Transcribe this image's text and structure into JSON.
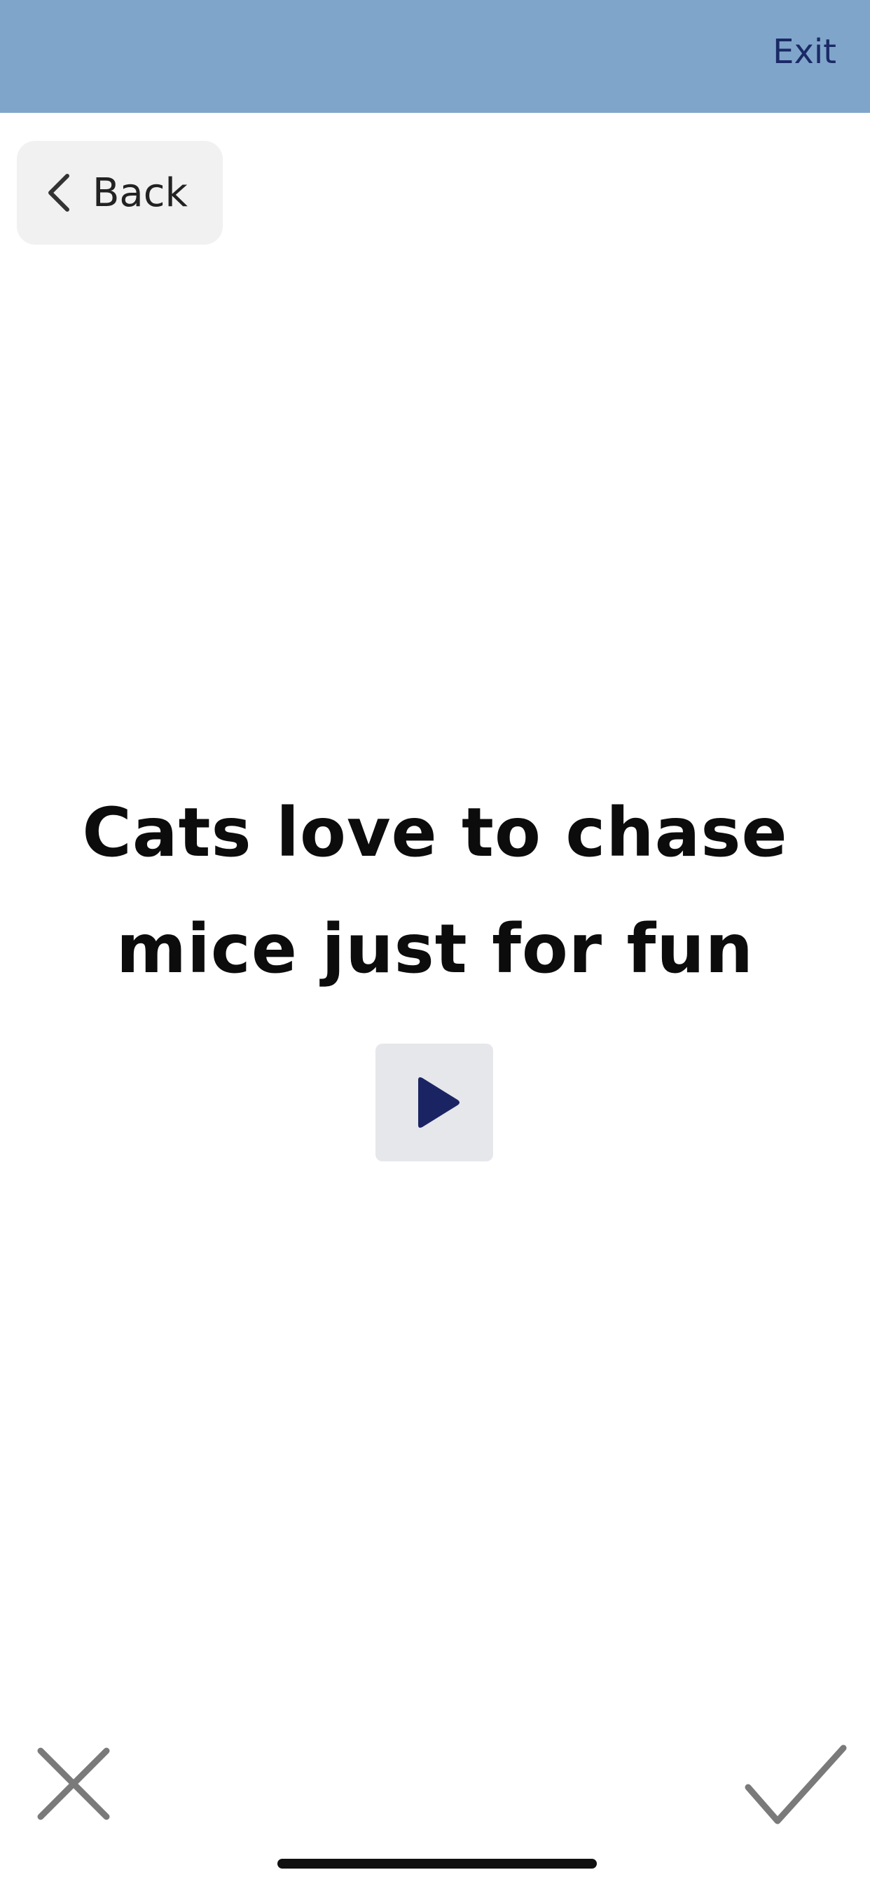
{
  "header": {
    "exit_label": "Exit",
    "background_color": "#80a5ca",
    "exit_color": "#1a2a66"
  },
  "back": {
    "label": "Back",
    "icon": "chevron-left-icon"
  },
  "card": {
    "sentence_line1": "Cats love to chase",
    "sentence_line2": "mice just for fun",
    "play_icon": "play-icon",
    "play_color": "#1b2463"
  },
  "footer": {
    "reject_icon": "close-icon",
    "accept_icon": "checkmark-icon",
    "icon_color": "#7a7a7a"
  }
}
